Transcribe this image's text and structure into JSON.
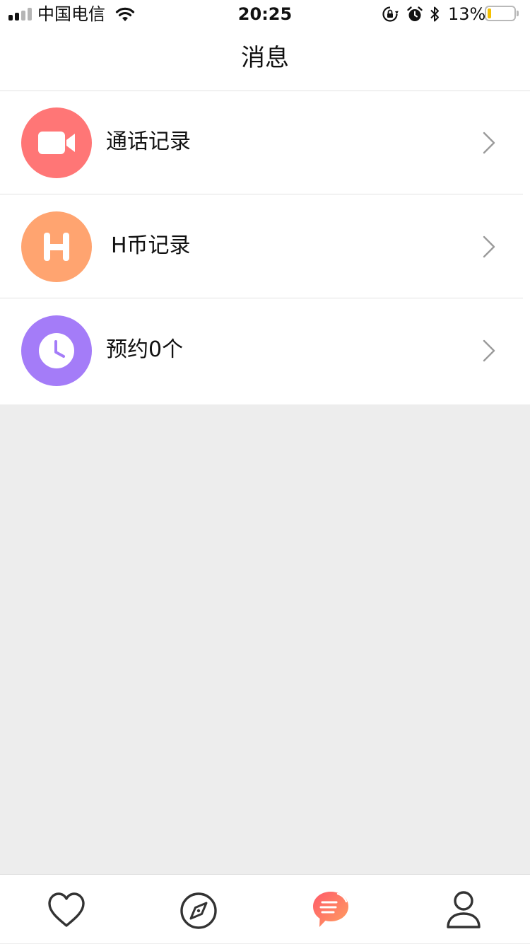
{
  "status_bar": {
    "carrier": "中国电信",
    "time": "20:25",
    "battery_percent_text": "13%",
    "battery_level": 0.13,
    "battery_color": "#f4c000",
    "signal_bars_active": 2,
    "icons": [
      "signal-icon",
      "wifi-icon",
      "rotation-lock-icon",
      "alarm-icon",
      "bluetooth-icon",
      "battery-icon"
    ]
  },
  "header": {
    "title": "消息"
  },
  "menu": {
    "items": [
      {
        "label": "通话记录",
        "icon": "video-camera-icon",
        "color": "#ff7676"
      },
      {
        "label": "H币记录",
        "icon": "h-coin-icon",
        "color": "#ffa470"
      },
      {
        "label": "预约0个",
        "icon": "clock-icon",
        "color": "#a47cf8"
      }
    ],
    "chevron_icon": "chevron-right-icon"
  },
  "tab_bar": {
    "tabs": [
      {
        "icon": "heart-icon",
        "active": false
      },
      {
        "icon": "compass-icon",
        "active": false
      },
      {
        "icon": "message-icon",
        "active": true
      },
      {
        "icon": "user-icon",
        "active": false
      }
    ],
    "active_color": "#ff5a5a",
    "inactive_color": "#333333"
  }
}
